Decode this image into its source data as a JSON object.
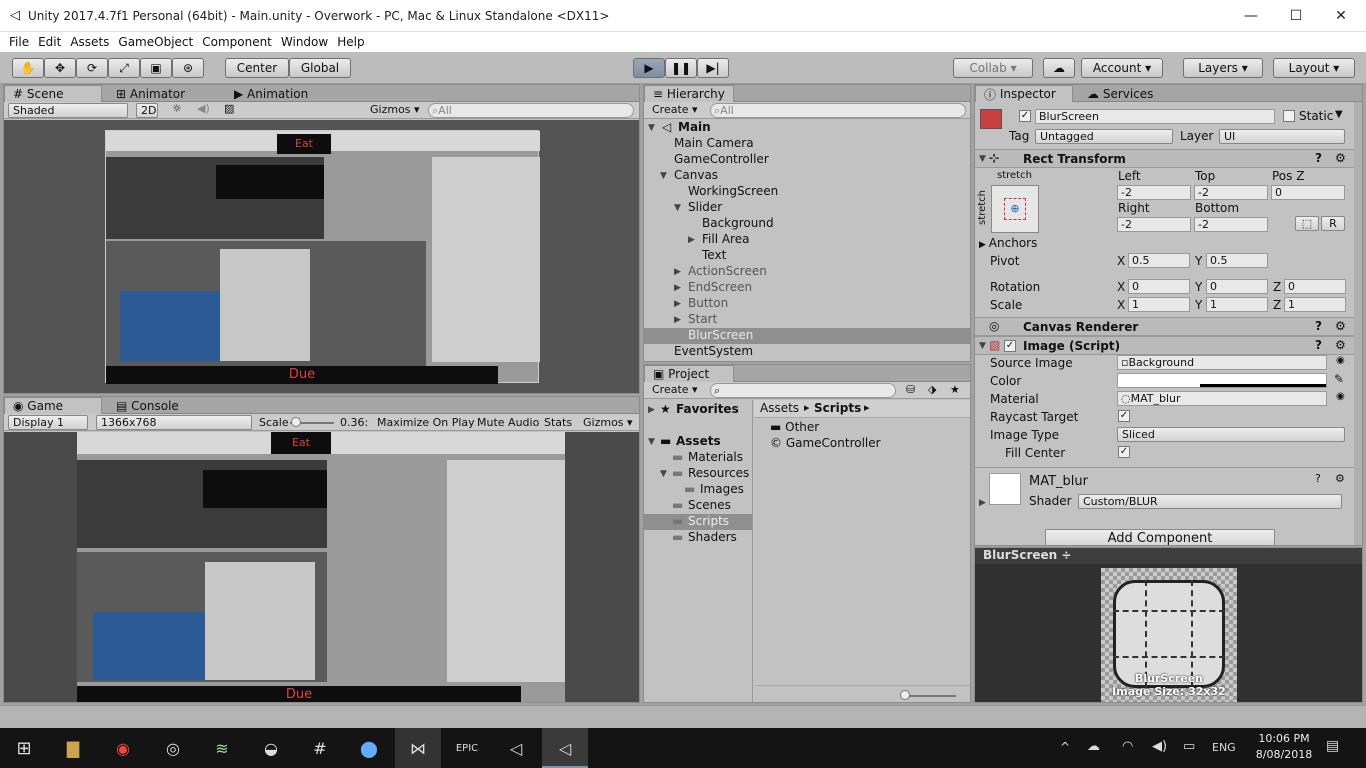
{
  "window": {
    "title": "Unity 2017.4.7f1 Personal (64bit) - Main.unity - Overwork - PC, Mac & Linux Standalone <DX11>",
    "minimize": "—",
    "maximize": "☐",
    "close": "✕"
  },
  "menu": [
    "File",
    "Edit",
    "Assets",
    "GameObject",
    "Component",
    "Window",
    "Help"
  ],
  "toolbar": {
    "center": "Center",
    "global": "Global",
    "collab": "Collab ▾",
    "account": "Account",
    "layers": "Layers",
    "layout": "Layout"
  },
  "scene": {
    "tabs": [
      "Scene",
      "Animator",
      "Animation"
    ],
    "shading": "Shaded",
    "mode2d": "2D",
    "gizmos": "Gizmos ▾",
    "search_placeholder": "All",
    "eat": "Eat",
    "due": "Due"
  },
  "game": {
    "tabs": [
      "Game",
      "Console"
    ],
    "display": "Display 1",
    "resolution": "1366x768",
    "scale_label": "Scale",
    "scale_value": "0.36:",
    "maximize": "Maximize On Play",
    "mute": "Mute Audio",
    "stats": "Stats",
    "gizmos": "Gizmos ▾",
    "eat": "Eat",
    "due": "Due"
  },
  "hierarchy": {
    "tab": "Hierarchy",
    "create": "Create ▾",
    "search_placeholder": "All",
    "scene": "Main",
    "items": [
      {
        "label": "Main Camera",
        "indent": 0,
        "arrow": ""
      },
      {
        "label": "GameController",
        "indent": 0,
        "arrow": ""
      },
      {
        "label": "Canvas",
        "indent": 0,
        "arrow": "▼"
      },
      {
        "label": "WorkingScreen",
        "indent": 1,
        "arrow": ""
      },
      {
        "label": "Slider",
        "indent": 1,
        "arrow": "▼"
      },
      {
        "label": "Background",
        "indent": 2,
        "arrow": ""
      },
      {
        "label": "Fill Area",
        "indent": 2,
        "arrow": "▶"
      },
      {
        "label": "Text",
        "indent": 2,
        "arrow": ""
      },
      {
        "label": "ActionScreen",
        "indent": 1,
        "arrow": "▶"
      },
      {
        "label": "EndScreen",
        "indent": 1,
        "arrow": "▶"
      },
      {
        "label": "Button",
        "indent": 1,
        "arrow": "▶"
      },
      {
        "label": "Start",
        "indent": 1,
        "arrow": "▶"
      },
      {
        "label": "BlurScreen",
        "indent": 1,
        "arrow": ""
      },
      {
        "label": "EventSystem",
        "indent": 0,
        "arrow": ""
      }
    ]
  },
  "project": {
    "tab": "Project",
    "create": "Create ▾",
    "favorites": "Favorites",
    "assets": "Assets",
    "breadcrumb_root": "Assets",
    "breadcrumb_current": "Scripts",
    "tree": [
      "Materials",
      "Resources",
      "Images",
      "Scenes",
      "Scripts",
      "Shaders"
    ],
    "files": [
      "Other",
      "GameController"
    ]
  },
  "inspector": {
    "tabs": [
      "Inspector",
      "Services"
    ],
    "name": "BlurScreen",
    "static": "Static",
    "tag_label": "Tag",
    "tag": "Untagged",
    "layer_label": "Layer",
    "layer": "UI",
    "rect": {
      "title": "Rect Transform",
      "anchor_preset": "stretch",
      "anchor_side": "stretch",
      "left_label": "Left",
      "left": "-2",
      "top_label": "Top",
      "top": "-2",
      "posz_label": "Pos Z",
      "posz": "0",
      "right_label": "Right",
      "right": "-2",
      "bottom_label": "Bottom",
      "bottom": "-2",
      "r": "R",
      "anchors": "Anchors",
      "pivot": "Pivot",
      "pivot_x": "0.5",
      "pivot_y": "0.5",
      "rotation": "Rotation",
      "rot_x": "0",
      "rot_y": "0",
      "rot_z": "0",
      "scale": "Scale",
      "sc_x": "1",
      "sc_y": "1",
      "sc_z": "1",
      "x": "X",
      "y": "Y",
      "z": "Z"
    },
    "canvas_renderer": "Canvas Renderer",
    "image": {
      "title": "Image (Script)",
      "source_label": "Source Image",
      "source": "Background",
      "color_label": "Color",
      "material_label": "Material",
      "material": "MAT_blur",
      "raycast": "Raycast Target",
      "type_label": "Image Type",
      "type": "Sliced",
      "fill": "Fill Center"
    },
    "mat": {
      "name": "MAT_blur",
      "shader_label": "Shader",
      "shader": "Custom/BLUR"
    },
    "add_component": "Add Component",
    "preview": {
      "title": "BlurScreen ÷",
      "caption": "BlurScreen",
      "size": "Image Size: 32x32"
    }
  },
  "taskbar": {
    "lang": "ENG",
    "time": "10:06 PM",
    "date": "8/08/2018"
  }
}
